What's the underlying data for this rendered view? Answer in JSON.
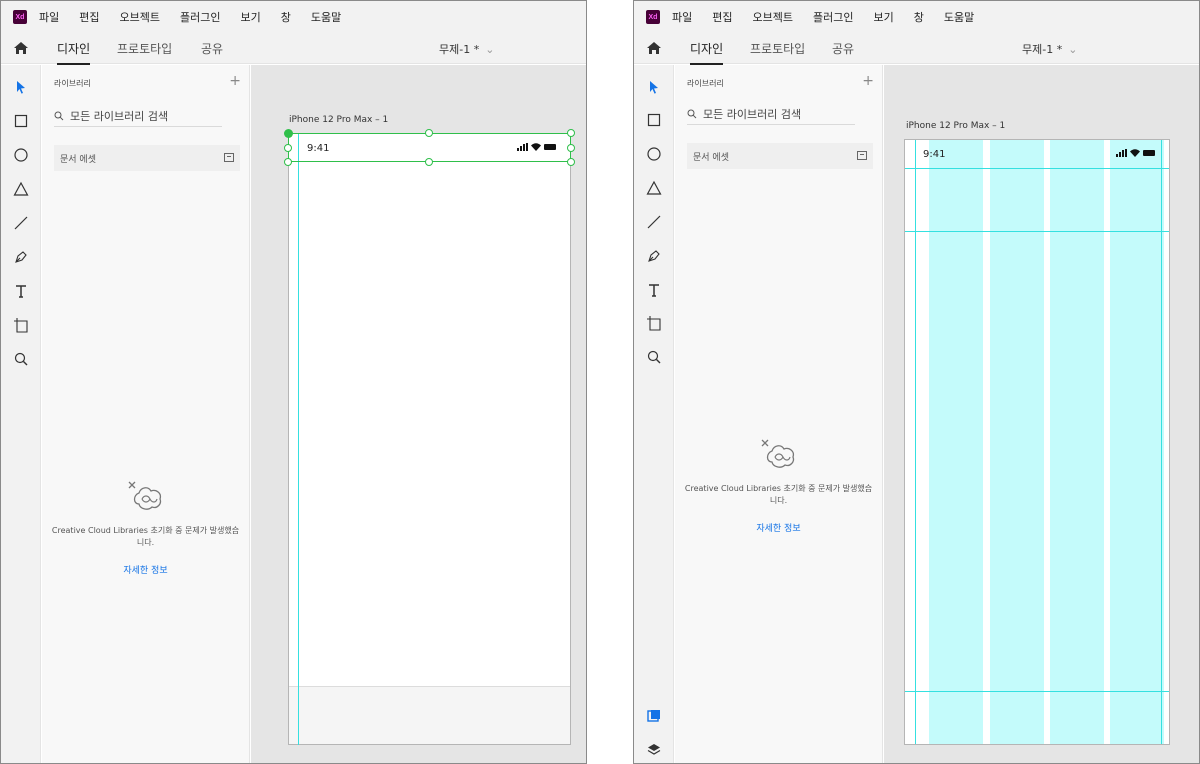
{
  "app": {
    "logo_text": "Xd",
    "menu": [
      "파일",
      "편집",
      "오브젝트",
      "플러그인",
      "보기",
      "창",
      "도움말"
    ],
    "tabs": [
      "디자인",
      "프로토타입",
      "공유"
    ],
    "active_tab": "디자인",
    "document_title": "무제-1 *"
  },
  "library": {
    "header": "라이브러리",
    "add_label": "+",
    "search_placeholder": "모든 라이브러리 검색",
    "document_assets": "문서 에셋",
    "error_message": "Creative Cloud Libraries 초기화 중 문제가 발생했습니다.",
    "learn_more": "자세한 정보"
  },
  "artboard": {
    "name": "iPhone 12 Pro Max – 1",
    "status_time": "9:41"
  },
  "icons": {
    "home": "home-icon",
    "select": "select-arrow-icon",
    "rectangle": "rectangle-icon",
    "ellipse": "ellipse-icon",
    "polygon": "triangle-icon",
    "line": "line-icon",
    "pen": "pen-icon",
    "text": "text-icon",
    "artboard": "artboard-icon",
    "zoom": "zoom-icon",
    "plugins": "plugins-icon",
    "layers": "layers-icon"
  },
  "colors": {
    "accent": "#1473e6",
    "selection": "#2fbf4a",
    "guide": "#35e0e0",
    "layout_column": "#c4fbfb",
    "xd_brand": "#470137"
  }
}
